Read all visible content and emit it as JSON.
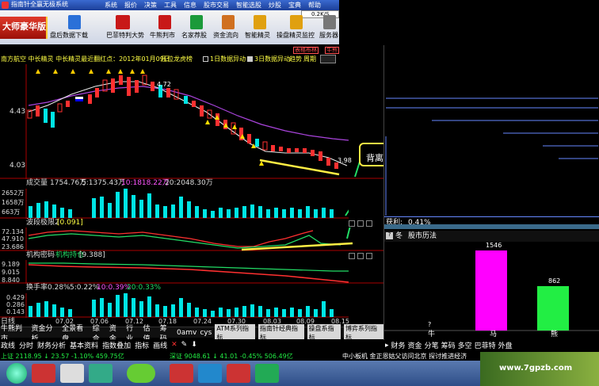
{
  "titlebar": {
    "app_title": "指南针全赢无极系统",
    "menu": [
      "系统",
      "报价",
      "决策",
      "工具",
      "信息",
      "股市交易",
      "智能选股",
      "炒股",
      "宝典",
      "帮助"
    ]
  },
  "toolbar": {
    "brand": "大师豪华版",
    "quote_badge": "0.2K/S",
    "buttons": [
      "盘后数据下载",
      "巴菲特判大势",
      "牛熊判市",
      "名家荐股",
      "资金流向",
      "智能精灵",
      "操盘精灵监控",
      "服务器"
    ]
  },
  "main_chart": {
    "header": "南方航空 中长精灵 中长精灵最近翻红点：2012年01月09日",
    "opt1": "压位龙虎榜",
    "opt2": "1日数据异动",
    "opt3": "3日数据异动",
    "opt4": "趋势",
    "opt5": "周期",
    "right_btn1": "表格布林",
    "right_btn2": "牛熊",
    "price_labels": [
      "4.43",
      "4.03"
    ],
    "hi_label": "4.72",
    "lo_label": "3.98",
    "annotation": "背离"
  },
  "volume": {
    "header_name": "成交量",
    "v1": "1754.76万",
    "v2": "5:1375.43万",
    "v3": "10:1818.22万",
    "v4": "20:2048.30万",
    "y_labels": [
      "2652万",
      "1658万",
      "663万"
    ]
  },
  "wave": {
    "header_name": "波段极限2",
    "value": "[0.091]",
    "y_labels": [
      "72.134",
      "47.910",
      "23.686"
    ]
  },
  "inst": {
    "header_name": "机构密码",
    "sub": "机构持仓",
    "value": "[9.388]",
    "y_labels": [
      "9.189",
      "9.015",
      "8.840"
    ]
  },
  "turnover": {
    "header_name": "换手率",
    "t1": "0.28%",
    "t2": "5:0.22%",
    "t3": "10:0.39%",
    "t4": "20:0.33%",
    "y_labels": [
      "0.429",
      "0.286",
      "0.143"
    ]
  },
  "xaxis": {
    "dates": [
      "07.02",
      "07.06",
      "07.12",
      "07.18",
      "07.24",
      "07.30",
      "08.03",
      "08.09",
      "08.15"
    ],
    "left_label": "日线"
  },
  "tabs_row1": [
    "牛熊判市",
    "资金分析",
    "全景看盘",
    "综合",
    "资金",
    "行业",
    "估值",
    "筹码",
    "0amv",
    "cys"
  ],
  "indicator_btns": [
    "ATM系列指标",
    "指南针经典指标",
    "操盘系指标",
    "博弈系列指标"
  ],
  "tabs_row2": [
    "政线",
    "分时",
    "财务分析",
    "基本资料",
    "指数叠加",
    "指标",
    "画线"
  ],
  "right_panel": {
    "profit_label": "获利:",
    "profit_value": "0.41%",
    "chart_title_prefix": "冬",
    "chart_title": "股市历法",
    "bar_labels": [
      "牛",
      "马",
      "熊"
    ],
    "bar_values": [
      "?",
      "1546",
      "862"
    ]
  },
  "bottom_tabs_right": [
    "财务",
    "资金",
    "分笔",
    "筹码",
    "多空",
    "巴菲特",
    "外盘"
  ],
  "statusbar": {
    "idx1": "上证 2118.95 ↓ 23.57 -1.10% 459.75亿",
    "idx2": "深证 9048.61 ↓ 41.01 -0.45% 506.49亿",
    "news": "中小板机 金正恩姑父访问北京 探讨推进经济"
  },
  "watermark": "www.7gpzb.com",
  "chart_data": {
    "type": "bar",
    "categories": [
      "牛",
      "马",
      "熊"
    ],
    "values": [
      0,
      1546,
      862
    ],
    "title": "股市历法"
  },
  "colors": {
    "up": "#ff3030",
    "down": "#00e5e5",
    "magenta": "#ff00ff",
    "green": "#22ee44",
    "yellow": "#ffff44"
  }
}
